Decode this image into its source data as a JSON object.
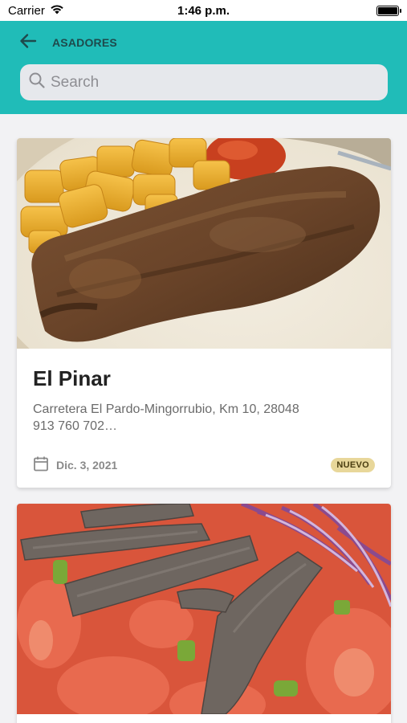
{
  "status_bar": {
    "carrier": "Carrier",
    "time": "1:46 p.m.",
    "battery_level": 1.0
  },
  "header": {
    "back_icon": "arrow-left-icon",
    "title": "ASADORES",
    "background_color": "#20bcb8"
  },
  "search": {
    "icon": "search-icon",
    "placeholder": "Search",
    "value": ""
  },
  "cards": [
    {
      "image": "grilled-steak-with-potatoes",
      "title": "El Pinar",
      "address_line1": "Carretera El Pardo-Mingorrubio, Km 10, 28048",
      "address_line2": "913 760 702…",
      "date_icon": "calendar-icon",
      "date": "Dic. 3, 2021",
      "badge": "NUEVO",
      "badge_color": "#e8d79a"
    },
    {
      "image": "sliced-meat-salad-with-tomato-and-onion"
    }
  ]
}
